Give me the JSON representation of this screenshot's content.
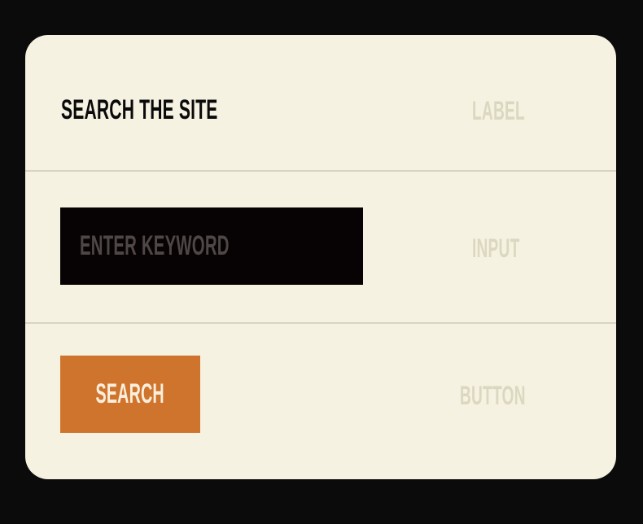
{
  "label_row": {
    "title": "SEARCH THE SITE",
    "tag": "LABEL"
  },
  "input_row": {
    "placeholder": "ENTER KEYWORD",
    "value": "",
    "tag": "INPUT"
  },
  "button_row": {
    "button_label": "SEARCH",
    "tag": "BUTTON"
  },
  "colors": {
    "background": "#0b0b0b",
    "card": "#f6f2e2",
    "divider": "#d9d4c1",
    "title_text": "#0a0a0a",
    "tag_text": "#dcd7bf",
    "input_background": "#070203",
    "input_placeholder": "#4f4746",
    "button_background": "#cf742d",
    "button_text": "#fbefdc"
  }
}
